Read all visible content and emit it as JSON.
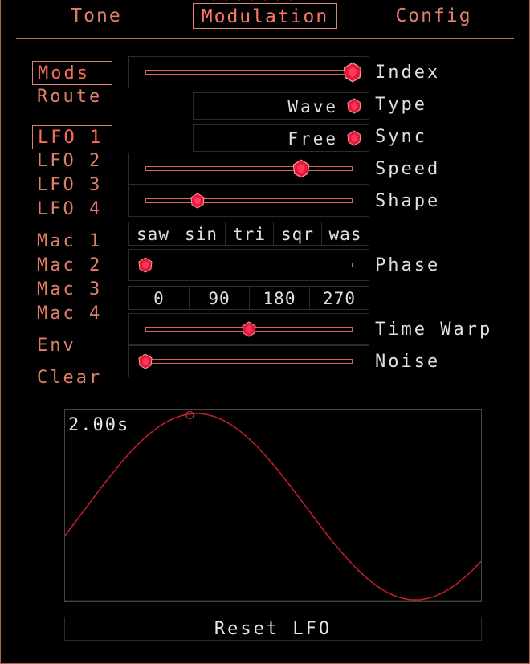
{
  "tabs": [
    {
      "label": "Tone"
    },
    {
      "label": "Modulation"
    },
    {
      "label": "Config"
    }
  ],
  "sidebar": {
    "items": [
      {
        "label": "Mods"
      },
      {
        "label": "Route"
      },
      {
        "label": "LFO 1"
      },
      {
        "label": "LFO 2"
      },
      {
        "label": "LFO 3"
      },
      {
        "label": "LFO 4"
      },
      {
        "label": "Mac 1"
      },
      {
        "label": "Mac 2"
      },
      {
        "label": "Mac 3"
      },
      {
        "label": "Mac 4"
      },
      {
        "label": "Env"
      },
      {
        "label": "Clear"
      }
    ]
  },
  "controls": {
    "index": {
      "label": "Index",
      "value": 1.0
    },
    "type": {
      "label": "Type",
      "value": "Wave"
    },
    "sync": {
      "label": "Sync",
      "value": "Free"
    },
    "speed": {
      "label": "Speed",
      "value": 0.75
    },
    "shape": {
      "label": "Shape",
      "value": 0.25
    },
    "shape_presets": [
      "saw",
      "sin",
      "tri",
      "sqr",
      "was"
    ],
    "phase": {
      "label": "Phase",
      "value": 0.0
    },
    "phase_presets": [
      "0",
      "90",
      "180",
      "270"
    ],
    "time_warp": {
      "label": "Time Warp",
      "value": 0.5
    },
    "noise": {
      "label": "Noise",
      "value": 0.0
    }
  },
  "scope": {
    "time_label": "2.00s",
    "playhead": 0.3
  },
  "reset_label": "Reset LFO",
  "colors": {
    "accent": "#e0806a",
    "active": "#ff6a5a",
    "knob": "#e8173a",
    "wave": "#c81e2a"
  }
}
